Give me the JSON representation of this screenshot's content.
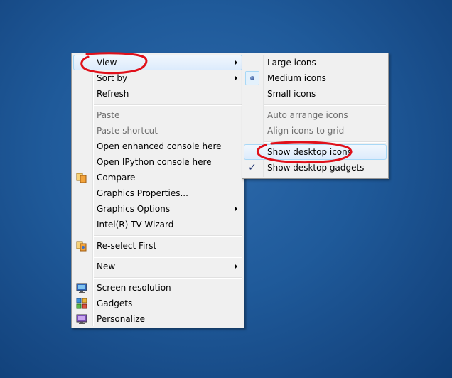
{
  "main_menu": {
    "items": [
      {
        "label": "View",
        "state": "hover",
        "has_submenu": true
      },
      {
        "label": "Sort by",
        "has_submenu": true
      },
      {
        "label": "Refresh"
      },
      {
        "label": "Paste",
        "disabled": true
      },
      {
        "label": "Paste shortcut",
        "disabled": true
      },
      {
        "label": "Open enhanced console here"
      },
      {
        "label": "Open IPython console here"
      },
      {
        "label": "Compare",
        "icon": "compare-icon"
      },
      {
        "label": "Graphics Properties..."
      },
      {
        "label": "Graphics Options",
        "has_submenu": true
      },
      {
        "label": "Intel(R) TV Wizard"
      },
      {
        "label": "Re-select First",
        "icon": "reselect-icon"
      },
      {
        "label": "New",
        "has_submenu": true
      },
      {
        "label": "Screen resolution",
        "icon": "screen-resolution-icon"
      },
      {
        "label": "Gadgets",
        "icon": "gadgets-icon"
      },
      {
        "label": "Personalize",
        "icon": "personalize-icon"
      }
    ]
  },
  "view_submenu": {
    "items": [
      {
        "label": "Large icons"
      },
      {
        "label": "Medium icons",
        "selected": true
      },
      {
        "label": "Small icons"
      },
      {
        "label": "Auto arrange icons",
        "disabled": true
      },
      {
        "label": "Align icons to grid",
        "disabled": true
      },
      {
        "label": "Show desktop icons",
        "state": "hover"
      },
      {
        "label": "Show desktop gadgets",
        "checked": true
      }
    ]
  },
  "colors": {
    "desktop_background": "#1f5a9a",
    "menu_background": "#f0f0f0",
    "hover_border": "#a8d8f6",
    "annotation_red": "#e0101a"
  }
}
